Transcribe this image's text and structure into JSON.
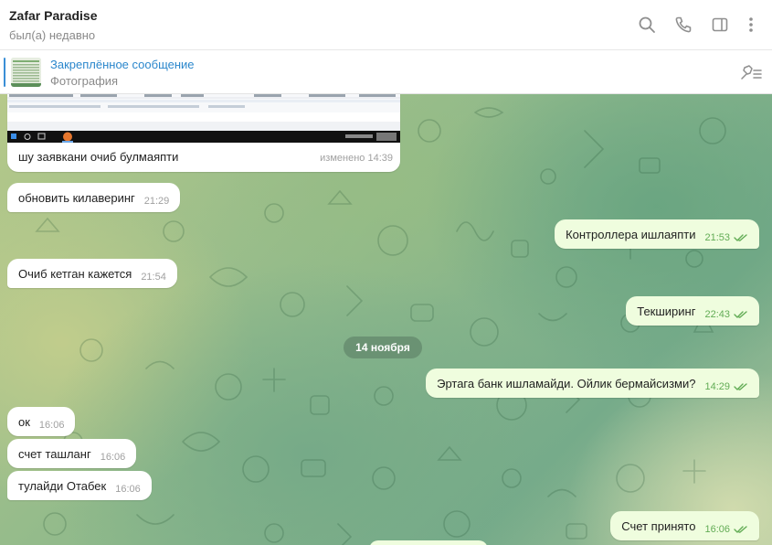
{
  "header": {
    "title": "Zafar Paradise",
    "status": "был(а) недавно",
    "icons": [
      "search-icon",
      "phone-icon",
      "sidebar-icon",
      "more-icon"
    ]
  },
  "pinned": {
    "title": "Закреплённое сообщение",
    "subtitle": "Фотография",
    "icon": "pinned-list-icon"
  },
  "colors": {
    "accent": "#2b87cc",
    "outgoing_bubble": "#effdde",
    "incoming_bubble": "#ffffff",
    "time_outgoing": "#62ac55",
    "date_pill": "#587860"
  },
  "image_message": {
    "caption": "шу заявкани очиб булмаяпти",
    "meta": "изменено 14:39"
  },
  "date_separator": "14 ноября",
  "messages": [
    {
      "id": "m1",
      "direction": "in",
      "text": "обновить килаверинг",
      "time": "21:29"
    },
    {
      "id": "m2",
      "direction": "out",
      "text": "Контроллера ишлаяпти",
      "time": "21:53"
    },
    {
      "id": "m3",
      "direction": "in",
      "text": "Очиб кетган кажется",
      "time": "21:54"
    },
    {
      "id": "m4",
      "direction": "out",
      "text": "Текширинг",
      "time": "22:43"
    },
    {
      "id": "m5",
      "direction": "out",
      "text": "Эртага банк ишламайди. Ойлик бермайсизми?",
      "time": "14:29"
    },
    {
      "id": "m6",
      "direction": "in",
      "text": "ок",
      "time": "16:06"
    },
    {
      "id": "m7",
      "direction": "in",
      "text": "счет ташланг",
      "time": "16:06"
    },
    {
      "id": "m8",
      "direction": "in",
      "text": "тулайди Отабек",
      "time": "16:06"
    },
    {
      "id": "m9",
      "direction": "out",
      "text": "Счет принято",
      "time": "16:06"
    }
  ]
}
